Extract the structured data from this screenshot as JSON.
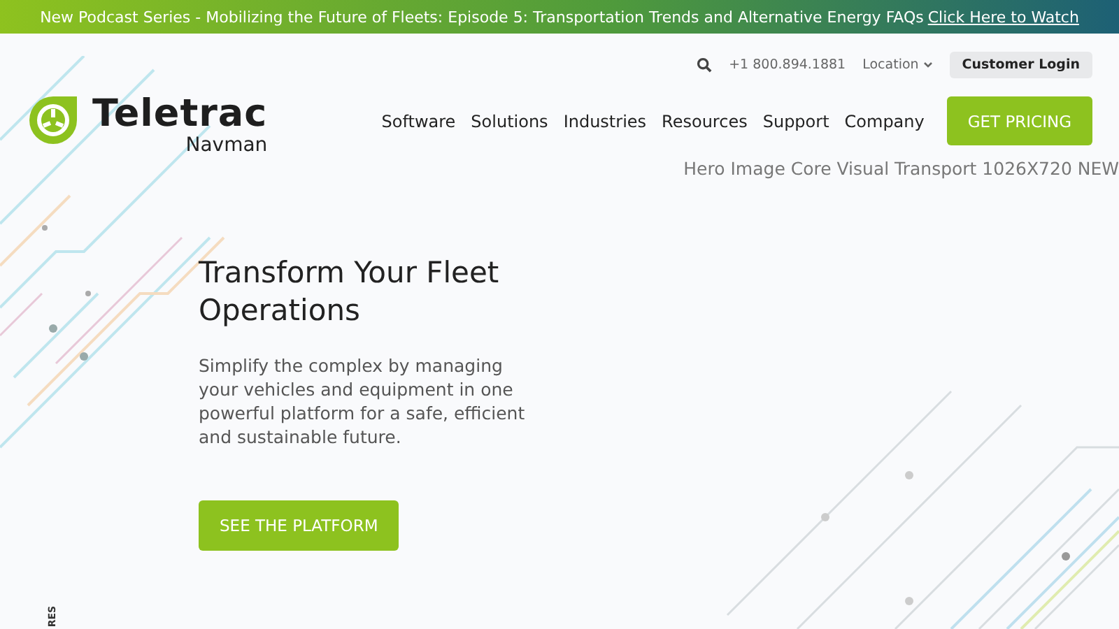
{
  "banner": {
    "text": "New Podcast Series - Mobilizing the Future of Fleets: Episode 5: Transportation Trends and Alternative Energy FAQs",
    "link": "Click Here to Watch"
  },
  "utility": {
    "phone": "+1 800.894.1881",
    "location": "Location",
    "login": "Customer Login"
  },
  "logo": {
    "name": "Teletrac",
    "sub": "Navman"
  },
  "nav": [
    "Software",
    "Solutions",
    "Industries",
    "Resources",
    "Support",
    "Company"
  ],
  "cta": "GET PRICING",
  "hero_image_alt": "Hero Image Core Visual Transport 1026X720 NEW",
  "hero": {
    "title": "Transform Your Fleet Operations",
    "text": "Simplify the complex by managing your vehicles and equipment in one powerful platform for a safe, efficient and sustainable future.",
    "button": "SEE THE PLATFORM"
  },
  "side_label": "RES"
}
